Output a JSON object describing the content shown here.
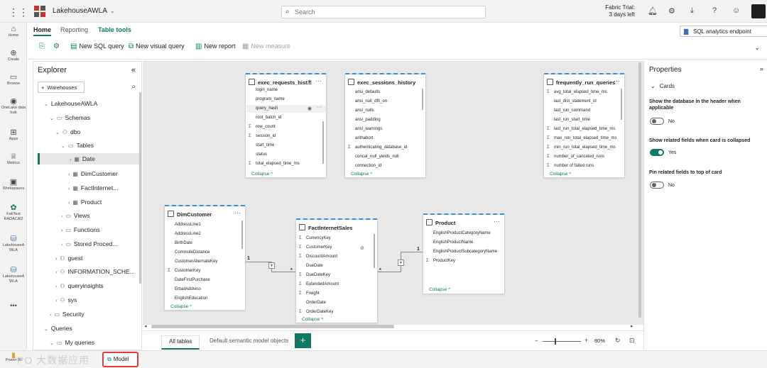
{
  "topbar": {
    "workspace": "LakehouseAWLA",
    "search_placeholder": "Search",
    "trial_line1": "Fabric Trial:",
    "trial_line2": "3 days left"
  },
  "rail": [
    {
      "label": "Home",
      "icon": "home-icon"
    },
    {
      "label": "Create",
      "icon": "plus-circle-icon"
    },
    {
      "label": "Browse",
      "icon": "folder-icon"
    },
    {
      "label": "OneLake data hub",
      "icon": "onelake-icon"
    },
    {
      "label": "Apps",
      "icon": "apps-icon"
    },
    {
      "label": "Metrics",
      "icon": "trophy-icon"
    },
    {
      "label": "Workspaces",
      "icon": "workspaces-icon"
    },
    {
      "label": "FabTest RADACAD",
      "icon": "workspace-icon"
    },
    {
      "label": "LakehouseA WLA",
      "icon": "lakehouse-icon"
    },
    {
      "label": "LakehouseA WLA",
      "icon": "lakehouse-icon"
    },
    {
      "label": "•••",
      "icon": "more-icon"
    }
  ],
  "ribbon": {
    "tabs": [
      "Home",
      "Reporting",
      "Table tools"
    ],
    "new_sql_query": "New SQL query",
    "new_visual_query": "New visual query",
    "new_report": "New report",
    "new_measure": "New measure",
    "endpoint": "SQL analytics endpoint"
  },
  "explorer": {
    "title": "Explorer",
    "warehouses": "Warehouses",
    "tree": [
      "LakehouseAWLA",
      "Schemas",
      "dbo",
      "Tables",
      "Date",
      "DimCustomer",
      "FactInternet...",
      "Product",
      "Views",
      "Functions",
      "Stored Proced...",
      "guest",
      "INFORMATION_SCHE...",
      "queryinsights",
      "sys",
      "Security",
      "Queries",
      "My queries"
    ]
  },
  "cards": {
    "exec_requests": {
      "title": "exec_requests_hist...",
      "fields": [
        "login_name",
        "program_name",
        "query_hash",
        "root_batch_id",
        "row_count",
        "session_id",
        "start_time",
        "status",
        "total_elapsed_time_ms"
      ],
      "collapse": "Collapse"
    },
    "exec_sessions": {
      "title": "exec_sessions_history",
      "fields": [
        "ansi_defaults",
        "ansi_null_dflt_on",
        "ansi_nulls",
        "ansi_padding",
        "ansi_warnings",
        "arithabort",
        "authenticating_database_id",
        "concat_null_yields_null",
        "connection_id"
      ],
      "collapse": "Collapse"
    },
    "frequent": {
      "title": "frequently_run_queries",
      "fields": [
        "avg_total_elapsed_time_ms",
        "last_dist_statement_id",
        "last_run_command",
        "last_run_start_time",
        "last_run_total_elapsed_time_ms",
        "max_run_total_elapsed_time_ms",
        "min_run_total_elapsed_time_ms",
        "number_of_canceled_runs",
        "number of failed runs"
      ],
      "collapse": "Collapse"
    },
    "dimcustomer": {
      "title": "DimCustomer",
      "fields": [
        "AddressLine1",
        "AddressLine2",
        "BirthDate",
        "CommuteDistance",
        "CustomerAlternateKey",
        "CustomerKey",
        "DateFirstPurchase",
        "EmailAddress",
        "EnglishEducation"
      ],
      "collapse": "Collapse"
    },
    "fact": {
      "title": "FactInternetSales",
      "fields": [
        "CurrencyKey",
        "CustomerKey",
        "DiscountAmount",
        "DueDate",
        "DueDateKey",
        "ExtendedAmount",
        "Freight",
        "OrderDate",
        "OrderDateKey"
      ],
      "collapse": "Collapse"
    },
    "product": {
      "title": "Product",
      "fields": [
        "EnglishProductCategoryName",
        "EnglishProductName",
        "EnglishProductSubcategoryName",
        "ProductKey"
      ],
      "collapse": "Collapse"
    }
  },
  "relationships": {
    "one": "1",
    "many": "*"
  },
  "bottom": {
    "all_tables": "All tables",
    "default_objects": "Default semantic model objects",
    "add": "+",
    "zoom": "80%"
  },
  "properties": {
    "title": "Properties",
    "section": "Cards",
    "opt1": "Show the database in the header when applicable",
    "opt1_val": "No",
    "opt2": "Show related fields when card is collapsed",
    "opt2_val": "Yes",
    "opt3": "Pin related fields to top of card",
    "opt3_val": "No"
  },
  "footer": {
    "powerbi": "Power BI",
    "model_tab": "Model",
    "watermark": "PO 大数据应用"
  }
}
